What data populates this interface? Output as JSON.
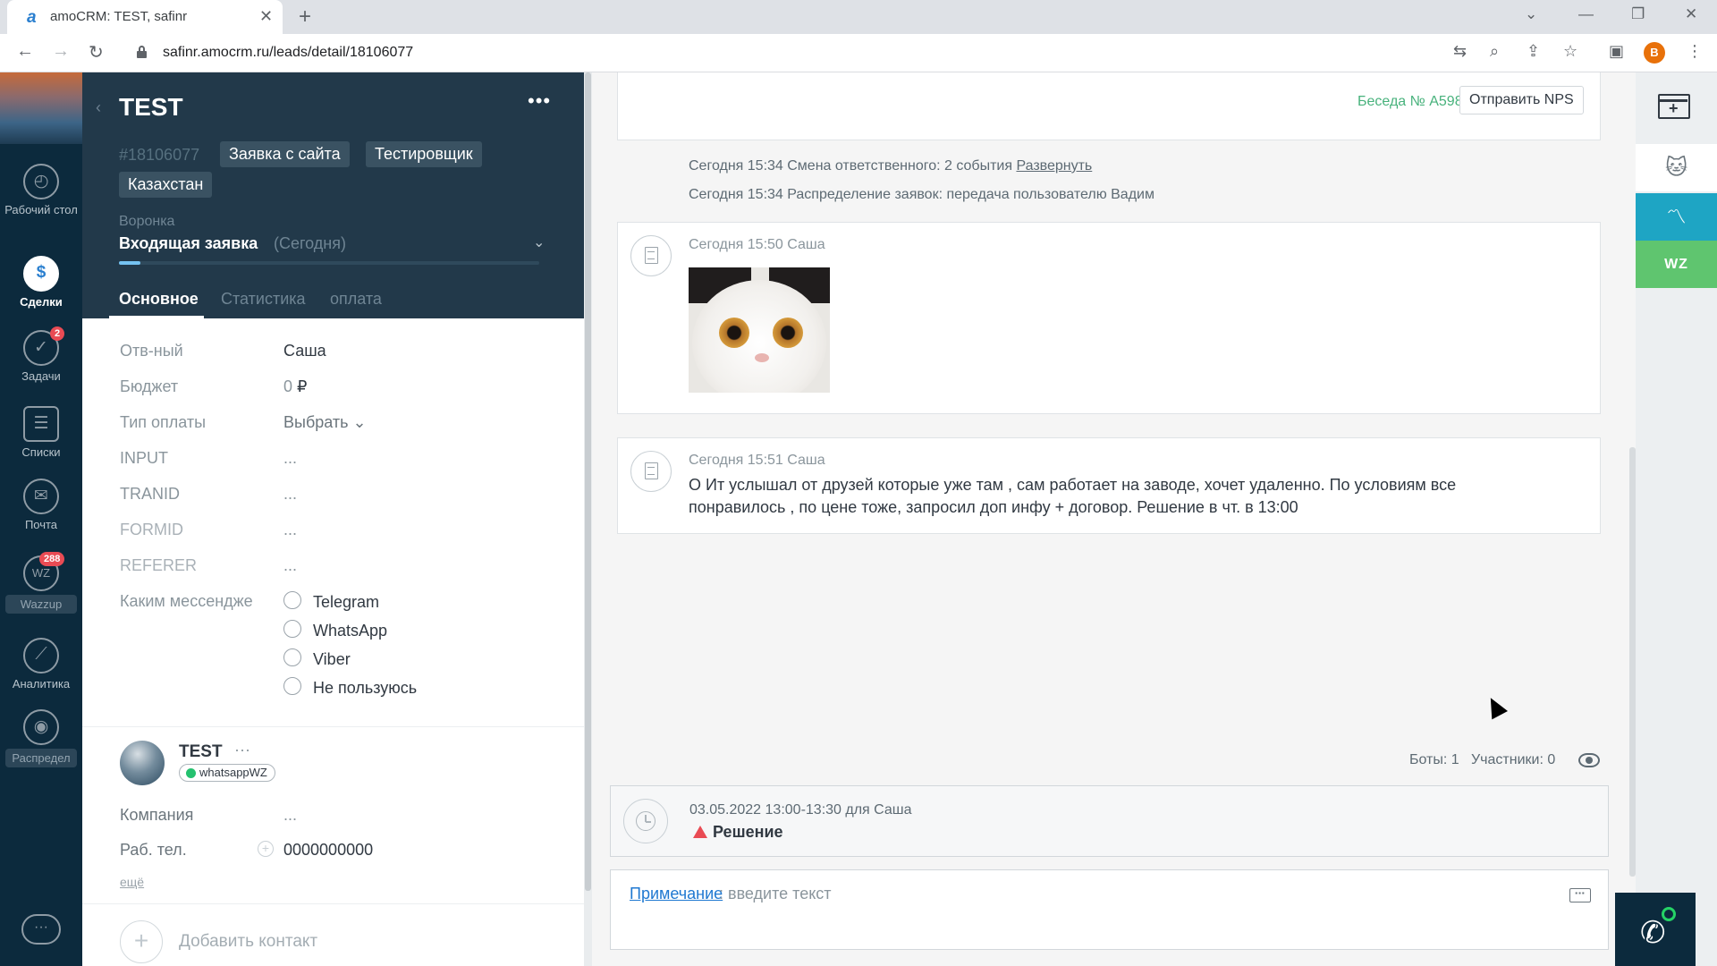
{
  "browser": {
    "tab_title": "amoCRM: TEST, safinr",
    "favicon": "a",
    "new_tab": "+",
    "url": "safinr.amocrm.ru/leads/detail/18106077",
    "profile_initial": "B"
  },
  "nav": {
    "dashboard": "Рабочий стол",
    "deals": "Сделки",
    "tasks": "Задачи",
    "tasks_badge": "2",
    "lists": "Списки",
    "mail": "Почта",
    "wazzup": "Wazzup",
    "wazzup_badge": "288",
    "analytics": "Аналитика",
    "distribution": "Распредел"
  },
  "lead": {
    "title": "TEST",
    "id": "#18106077",
    "tags": [
      "Заявка с сайта",
      "Тестировщик",
      "Казахстан"
    ],
    "funnel_label": "Воронка",
    "funnel_stage": "Входящая заявка",
    "funnel_date": "(Сегодня)",
    "funnel_progress": 0.05,
    "tabs": [
      "Основное",
      "Статистика",
      "оплата"
    ]
  },
  "fields": {
    "responsible_label": "Отв-ный",
    "responsible_value": "Саша",
    "budget_label": "Бюджет",
    "budget_amount": "0",
    "budget_currency": "₽",
    "payment_label": "Тип оплаты",
    "payment_value": "Выбрать",
    "input_label": "INPUT",
    "tranid_label": "TRANID",
    "formid_label": "FORMID",
    "referer_label": "REFERER",
    "empty_value": "...",
    "messenger_label": "Каким мессендже",
    "messenger_options": [
      "Telegram",
      "WhatsApp",
      "Viber",
      "Не пользуюсь"
    ]
  },
  "contact": {
    "name": "TEST",
    "channel": "whatsappWZ",
    "company_label": "Компания",
    "company_value": "...",
    "phone_label": "Раб. тел.",
    "phone_value": "0000000000",
    "more": "ещё",
    "add_contact": "Добавить контакт"
  },
  "feed": {
    "conversation": "Беседа № A5986",
    "nps_button": "Отправить NPS",
    "event1_text": "Сегодня 15:34 Смена ответственного: 2 события ",
    "event1_link": "Развернуть",
    "event2_text": "Сегодня 15:34 Распределение заявок: передача пользователю Вадим",
    "msg1_meta": "Сегодня 15:50 Саша",
    "msg2_meta": "Сегодня 15:51 Саша",
    "msg2_text": "О Ит услышал от друзей которые уже там , сам работает на заводе, хочет удаленно. По условиям все понравилось , по цене тоже, запросил доп инфу + договор. Решение в чт. в 13:00",
    "stats": "Боты: 1   Участники: 0",
    "task_meta": "03.05.2022 13:00-13:30 для Саша",
    "task_title": "Решение",
    "composer_type": "Примечание",
    "composer_placeholder": ": введите текст"
  },
  "right_rail": {
    "wz_label": "WZ"
  },
  "colors": {
    "nav_bg": "#0c2a3d",
    "card_header_bg": "#22394a",
    "accent_green": "#48b27c",
    "link_blue": "#1f78d1",
    "badge_red": "#e94b54"
  }
}
